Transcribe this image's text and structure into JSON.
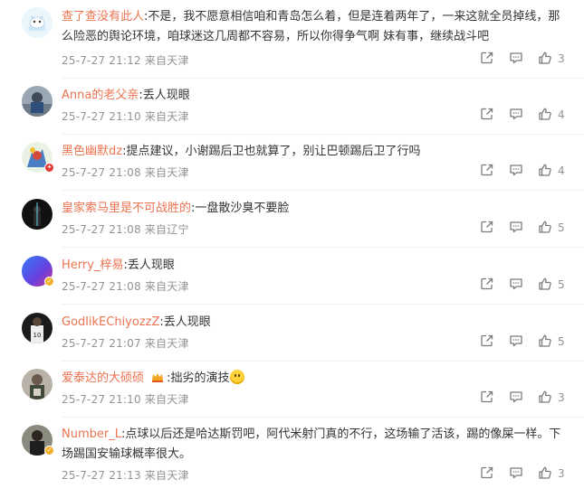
{
  "comments": [
    {
      "username": "查了查没有此人",
      "text": ":不是，我不愿意相信咱和青岛怎么着，但是连着两年了，一来这就全员掉线，那么险恶的舆论环境，咱球迷这几周都不容易，所以你得争气啊 妹有事，继续战斗吧",
      "meta": "25-7-27 21:12 来自天津",
      "likes": "3"
    },
    {
      "username": "Anna的老父亲",
      "text": ":丢人现眼",
      "meta": "25-7-27 21:10 来自天津",
      "likes": "4"
    },
    {
      "username": "黑色幽默dz",
      "text": ":提点建议，小谢踢后卫也就算了，别让巴顿踢后卫了行吗",
      "meta": "25-7-27 21:08 来自天津",
      "likes": "4"
    },
    {
      "username": "皇家索马里是不可战胜的",
      "text": ":一盘散沙臭不要脸",
      "meta": "25-7-27 21:08 来自辽宁",
      "likes": "5"
    },
    {
      "username": "Herry_梓易",
      "text": ":丢人现眼",
      "meta": "25-7-27 21:08 来自天津",
      "likes": "5"
    },
    {
      "username": "GodlikEChiyozzZ",
      "text": ":丢人现眼",
      "meta": "25-7-27 21:07 来自天津",
      "likes": "5"
    },
    {
      "username": "爱泰达的大硕硕",
      "text": ":拙劣的演技",
      "meta": "25-7-27 21:10 来自天津",
      "likes": "3"
    },
    {
      "username": "Number_L",
      "text": ":点球以后还是哈达斯罚吧，阿代米射门真的不行，这场输了活该，踢的像屎一样。下场踢国安输球概率很大。",
      "meta": "25-7-27 21:13 来自天津",
      "likes": "3"
    }
  ],
  "icons": {
    "share": "share-icon",
    "comment": "comment-icon",
    "like": "thumbs-up-icon"
  },
  "colors": {
    "username": "#eb7350",
    "meta": "#939393",
    "text": "#333333"
  }
}
